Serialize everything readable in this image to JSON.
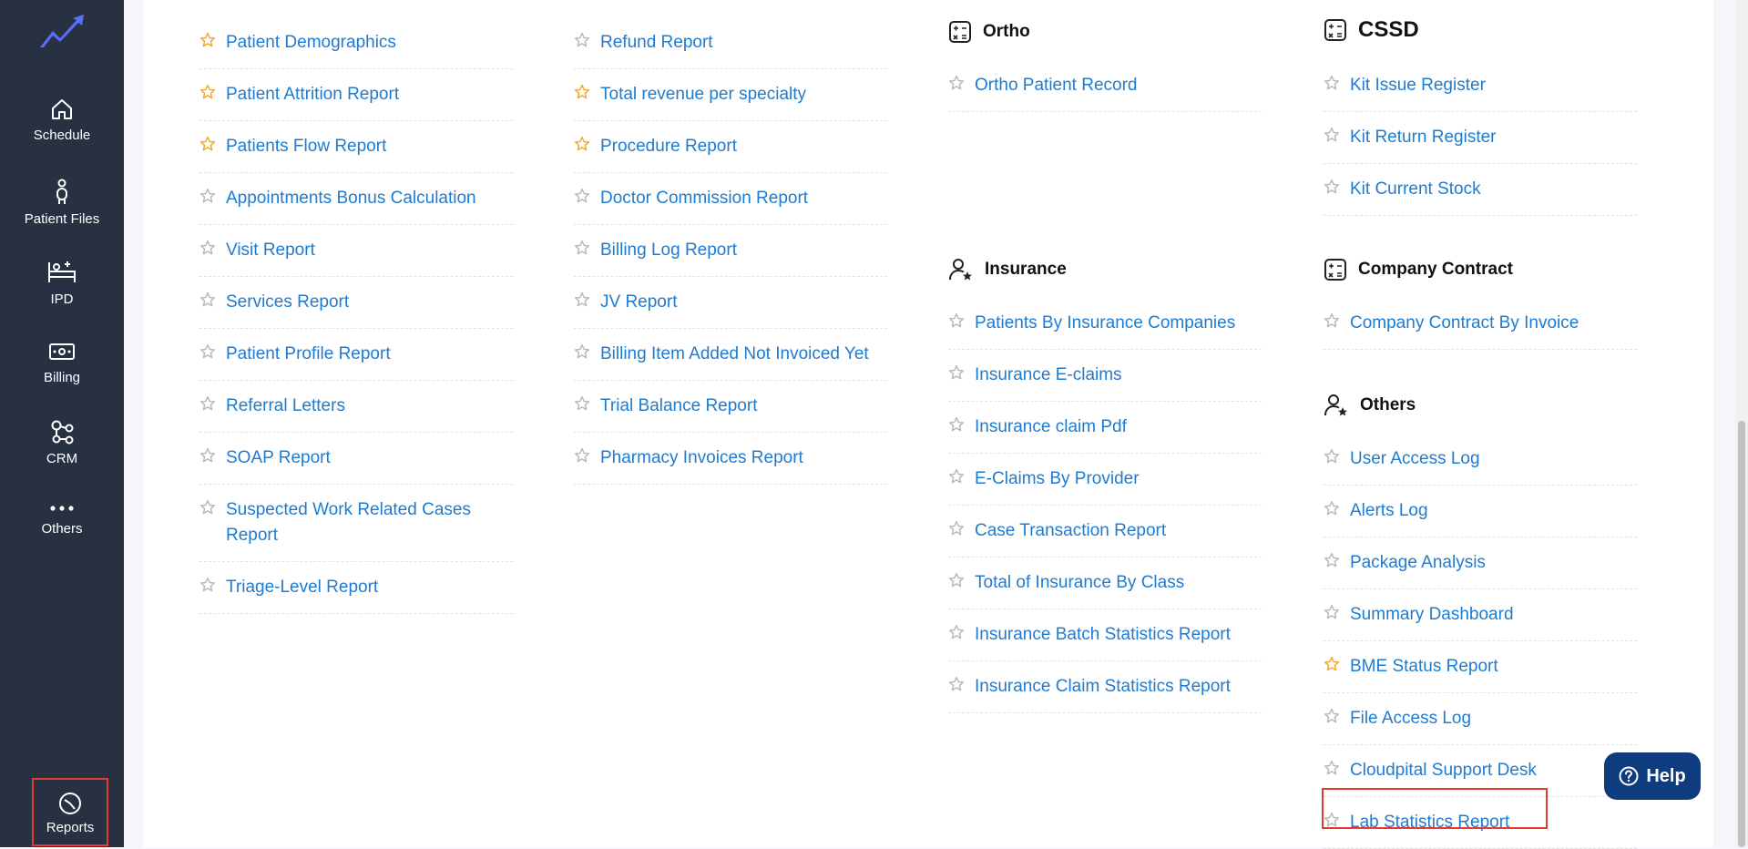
{
  "sidebar": {
    "items": [
      {
        "label": "Schedule",
        "icon": "home-icon"
      },
      {
        "label": "Patient Files",
        "icon": "person-icon"
      },
      {
        "label": "IPD",
        "icon": "bed-icon"
      },
      {
        "label": "Billing",
        "icon": "cash-icon"
      },
      {
        "label": "CRM",
        "icon": "network-icon"
      },
      {
        "label": "Others",
        "icon": "dots-icon"
      }
    ],
    "reports": {
      "label": "Reports",
      "icon": "pie-chart-icon"
    }
  },
  "columns": {
    "col1": [
      {
        "label": "Patient Demographics",
        "starred": true
      },
      {
        "label": "Patient Attrition Report",
        "starred": true
      },
      {
        "label": "Patients Flow Report",
        "starred": true
      },
      {
        "label": "Appointments Bonus Calculation",
        "starred": false
      },
      {
        "label": "Visit Report",
        "starred": false
      },
      {
        "label": "Services Report",
        "starred": false
      },
      {
        "label": "Patient Profile Report",
        "starred": false
      },
      {
        "label": "Referral Letters",
        "starred": false
      },
      {
        "label": "SOAP Report",
        "starred": false
      },
      {
        "label": "Suspected Work Related Cases Report",
        "starred": false
      },
      {
        "label": "Triage-Level Report",
        "starred": false
      }
    ],
    "col2": [
      {
        "label": "Refund Report",
        "starred": false
      },
      {
        "label": "Total revenue per specialty",
        "starred": true
      },
      {
        "label": "Procedure Report",
        "starred": true
      },
      {
        "label": "Doctor Commission Report",
        "starred": false
      },
      {
        "label": "Billing Log Report",
        "starred": false
      },
      {
        "label": "JV Report",
        "starred": false
      },
      {
        "label": "Billing Item Added Not Invoiced Yet",
        "starred": false
      },
      {
        "label": "Trial Balance Report",
        "starred": false
      },
      {
        "label": "Pharmacy Invoices Report",
        "starred": false
      }
    ]
  },
  "sections": {
    "ortho": {
      "title": "Ortho",
      "items": [
        {
          "label": "Ortho Patient Record",
          "starred": false
        }
      ]
    },
    "insurance": {
      "title": "Insurance",
      "items": [
        {
          "label": "Patients By Insurance Companies",
          "starred": false
        },
        {
          "label": "Insurance E-claims",
          "starred": false
        },
        {
          "label": "Insurance claim Pdf",
          "starred": false
        },
        {
          "label": "E-Claims By Provider",
          "starred": false
        },
        {
          "label": "Case Transaction Report",
          "starred": false
        },
        {
          "label": "Total of Insurance By Class",
          "starred": false
        },
        {
          "label": "Insurance Batch Statistics Report",
          "starred": false
        },
        {
          "label": "Insurance Claim Statistics Report",
          "starred": false
        }
      ]
    },
    "cssd": {
      "title": "CSSD",
      "items": [
        {
          "label": "Kit Issue Register",
          "starred": false
        },
        {
          "label": "Kit Return Register",
          "starred": false
        },
        {
          "label": "Kit Current Stock",
          "starred": false
        }
      ]
    },
    "company_contract": {
      "title": "Company Contract",
      "items": [
        {
          "label": "Company Contract By Invoice",
          "starred": false
        }
      ]
    },
    "others": {
      "title": "Others",
      "items": [
        {
          "label": "User Access Log",
          "starred": false
        },
        {
          "label": "Alerts Log",
          "starred": false
        },
        {
          "label": "Package Analysis",
          "starred": false
        },
        {
          "label": "Summary Dashboard",
          "starred": false
        },
        {
          "label": "BME Status Report",
          "starred": true
        },
        {
          "label": "File Access Log",
          "starred": false
        },
        {
          "label": "Cloudpital Support Desk",
          "starred": false
        },
        {
          "label": "Lab Statistics Report",
          "starred": false
        }
      ]
    }
  },
  "help": {
    "label": "Help"
  },
  "colors": {
    "link": "#1f7bd0",
    "star_active": "#f5a623",
    "star_inactive": "#b8b8b8",
    "sidebar": "#273142"
  }
}
